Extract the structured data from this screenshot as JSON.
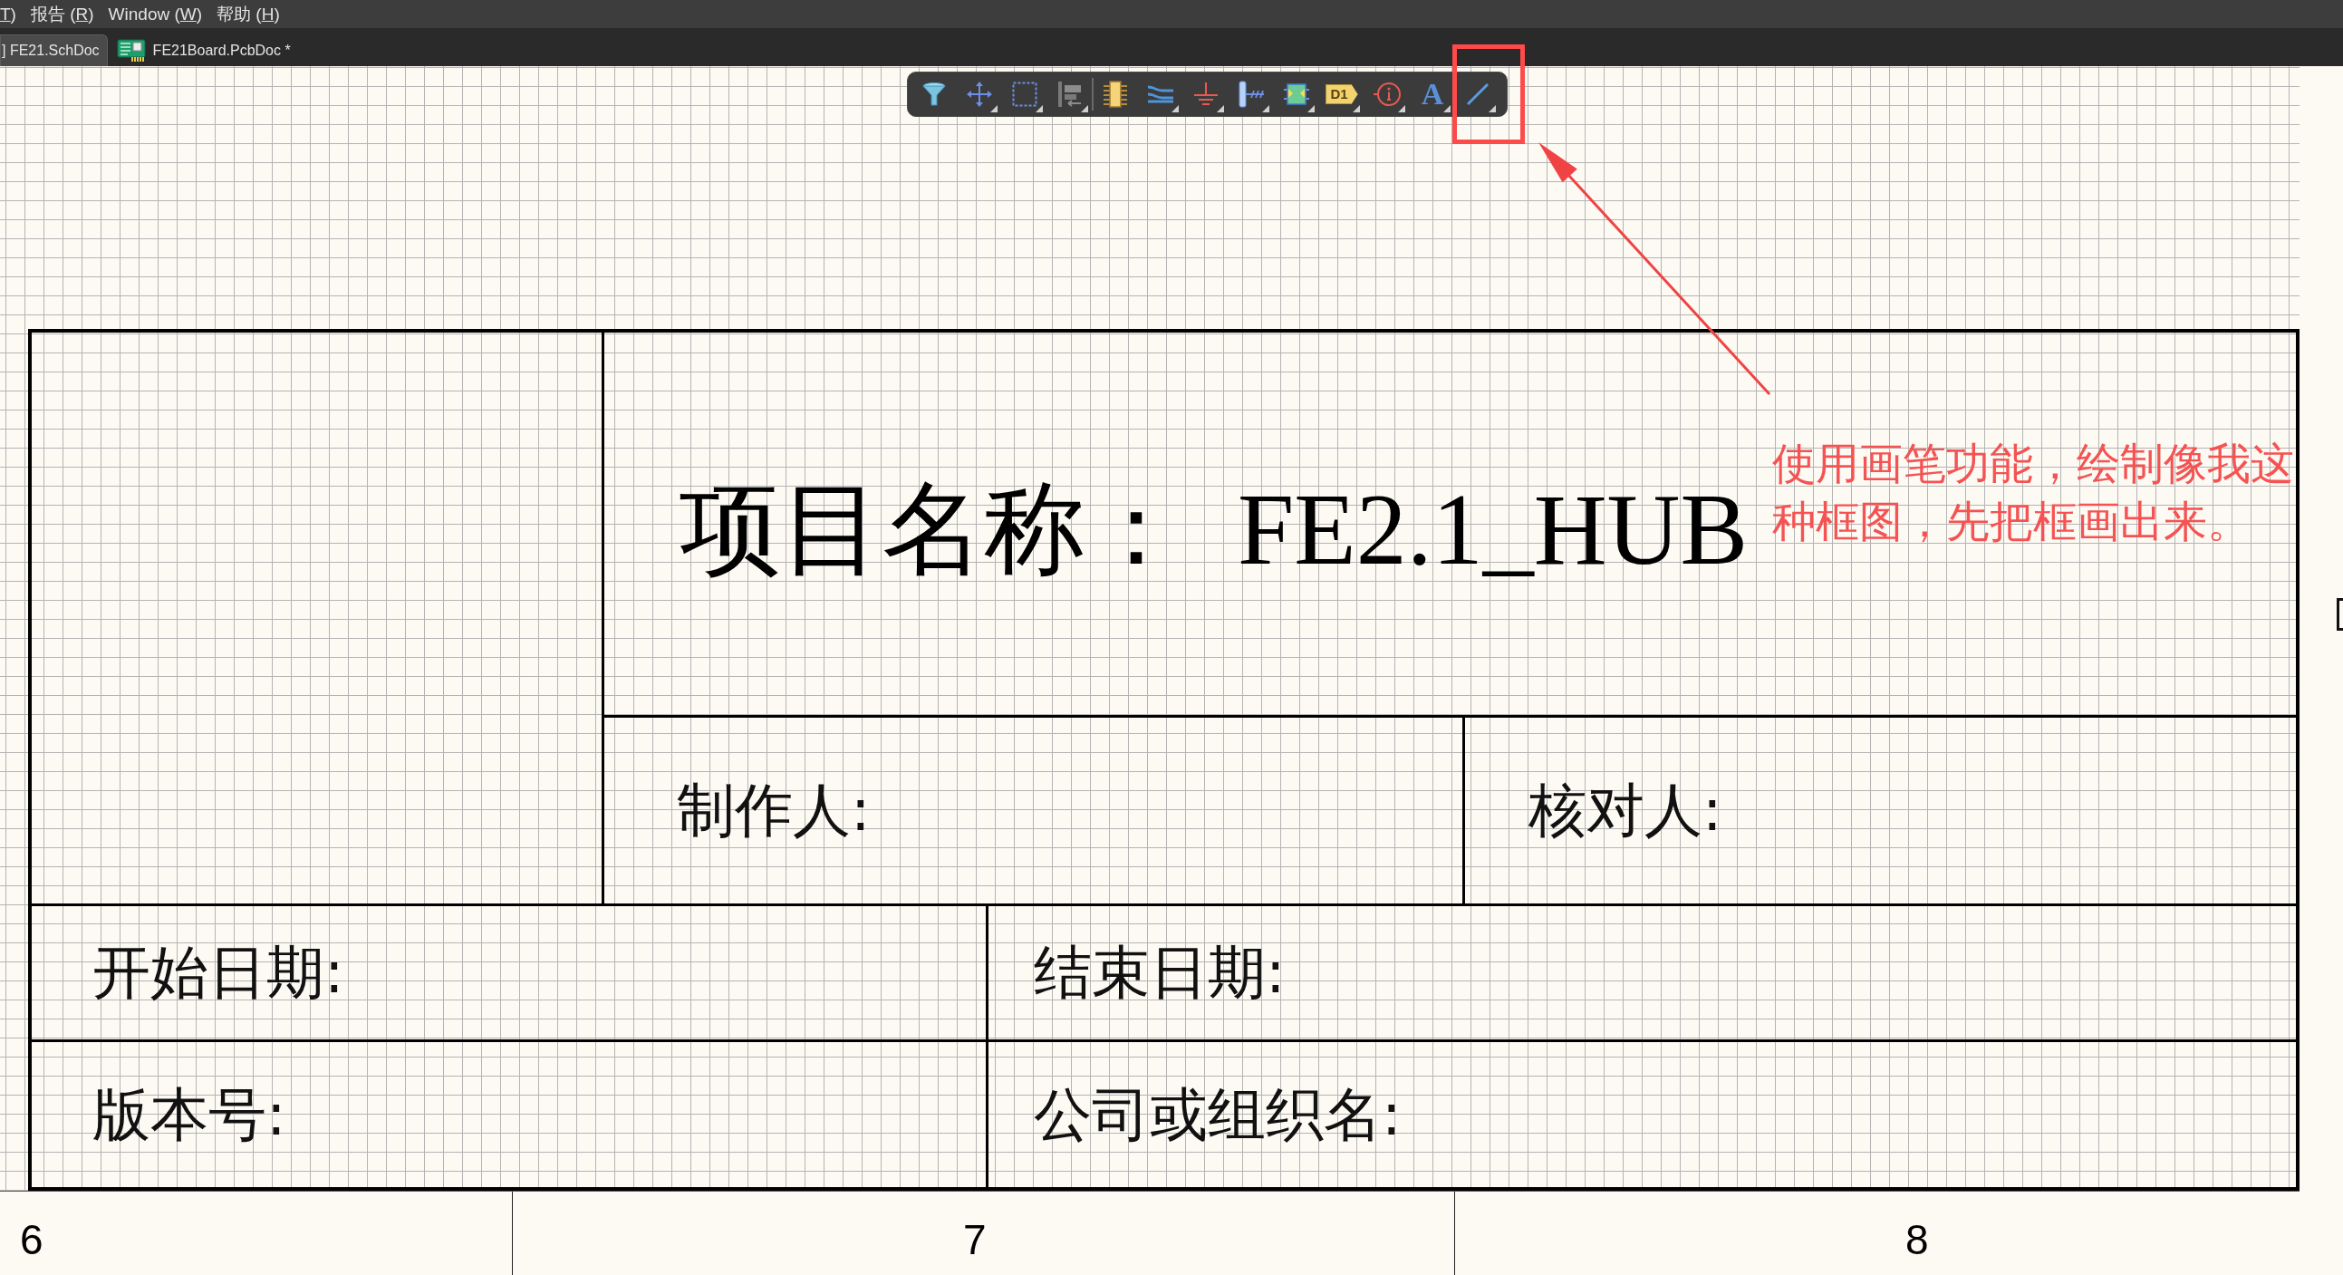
{
  "menu_bar": {
    "items": [
      {
        "key": "T",
        "after": ")"
      },
      {
        "before": "报告 (",
        "key": "R",
        "after": ")"
      },
      {
        "before": "Window (",
        "key": "W",
        "after": ")"
      },
      {
        "before": "帮助 (",
        "key": "H",
        "after": ")"
      }
    ]
  },
  "tabs": [
    {
      "label": "] FE21.SchDoc",
      "kind": "schematic",
      "selected": true
    },
    {
      "label": "FE21Board.PcbDoc *",
      "kind": "pcb",
      "selected": false
    }
  ],
  "toolbar": [
    {
      "kind": "filter",
      "dropdown": false
    },
    {
      "kind": "move",
      "dropdown": true
    },
    {
      "kind": "select",
      "dropdown": true
    },
    {
      "kind": "align",
      "dropdown": true
    },
    {
      "kind": "separator"
    },
    {
      "kind": "component",
      "dropdown": false
    },
    {
      "kind": "wire",
      "dropdown": true
    },
    {
      "kind": "power",
      "dropdown": true
    },
    {
      "kind": "harness",
      "dropdown": true
    },
    {
      "kind": "sheet",
      "dropdown": true
    },
    {
      "kind": "net_label",
      "glyph": "D1",
      "dropdown": true
    },
    {
      "kind": "parameter",
      "dropdown": true
    },
    {
      "kind": "text",
      "glyph": "A",
      "dropdown": true
    },
    {
      "kind": "line",
      "dropdown": true
    }
  ],
  "title_block": {
    "project_title": "项目名称：  FE2.1_HUB",
    "fields": [
      "制作人:",
      "核对人:",
      "开始日期:",
      "结束日期:",
      "版本号:",
      "公司或组织名:"
    ]
  },
  "annotation": {
    "note": "使用画笔功能，绘制像我这种框图，先把框画出来。"
  },
  "sheet_zones": [
    "6",
    "7",
    "8"
  ]
}
